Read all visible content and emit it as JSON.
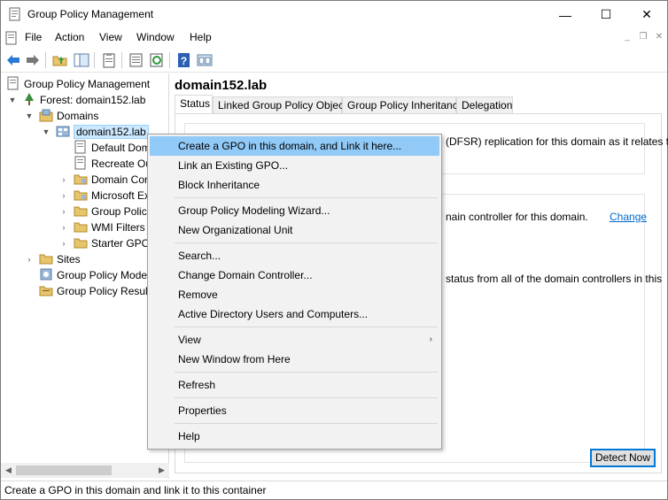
{
  "window": {
    "title": "Group Policy Management",
    "minimize_glyph": "—",
    "maximize_glyph": "☐",
    "close_glyph": "✕"
  },
  "menubar": {
    "items": [
      "File",
      "Action",
      "View",
      "Window",
      "Help"
    ],
    "mdi_minimize": "_",
    "mdi_restore": "❐",
    "mdi_close": "✕"
  },
  "toolbar": {
    "icons": [
      "back-icon",
      "forward-icon",
      "up-folder-icon",
      "show-hide-tree-icon",
      "clipboard-icon",
      "export-list-icon",
      "refresh-icon",
      "help-icon",
      "properties-icon"
    ]
  },
  "tree": {
    "root": "Group Policy Management",
    "forest": "Forest: domain152.lab",
    "domains": "Domains",
    "domain": "domain152.lab",
    "children": [
      "Default Dom",
      "Recreate Ou",
      "Domain Con",
      "Microsoft Ex",
      "Group Polic",
      "WMI Filters",
      "Starter GPO"
    ],
    "sites": "Sites",
    "modeling": "Group Policy Mode",
    "results": "Group Policy Resul"
  },
  "right": {
    "heading": "domain152.lab",
    "tabs": [
      "Status",
      "Linked Group Policy Objects",
      "Group Policy Inheritance",
      "Delegation"
    ],
    "text_replication": "(DFSR) replication for this domain as it relates to",
    "text_dc": "nain controller for this domain.",
    "change_link": "Change",
    "text_status": "status from all of the domain controllers in this",
    "detect_button": "Detect Now"
  },
  "context_menu": {
    "items": [
      {
        "label": "Create a GPO in this domain, and Link it here...",
        "highlighted": true
      },
      {
        "label": "Link an Existing GPO..."
      },
      {
        "label": "Block Inheritance"
      },
      {
        "label": "Group Policy Modeling Wizard..."
      },
      {
        "label": "New Organizational Unit"
      },
      {
        "label": "Search..."
      },
      {
        "label": "Change Domain Controller..."
      },
      {
        "label": "Remove"
      },
      {
        "label": "Active Directory Users and Computers..."
      },
      {
        "label": "View",
        "submenu": true
      },
      {
        "label": "New Window from Here"
      },
      {
        "label": "Refresh"
      },
      {
        "label": "Properties"
      },
      {
        "label": "Help"
      }
    ],
    "submenu_glyph": "›"
  },
  "statusbar": {
    "text": "Create a GPO in this domain and link it to this container"
  },
  "colors": {
    "highlight": "#91c9f7",
    "selection": "#cce8ff",
    "link": "#0066cc",
    "accent": "#0078d7"
  }
}
